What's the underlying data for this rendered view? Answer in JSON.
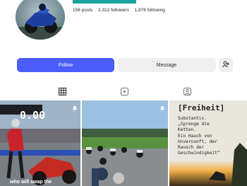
{
  "profile": {
    "stats": {
      "posts": "156 posts",
      "followers": "2,312 followers",
      "following": "1,976 following"
    }
  },
  "actions": {
    "follow_label": "Follow",
    "message_label": "Message"
  },
  "tabs": [
    {
      "icon": "grid-icon"
    },
    {
      "icon": "reels-icon"
    },
    {
      "icon": "tagged-icon"
    }
  ],
  "posts": [
    {
      "overlay_timer": "0.00",
      "caption": "who will swap the",
      "pinned": true
    },
    {
      "pinned": true
    },
    {
      "title": "[Freiheit]",
      "text": "Substantiv.\n„Sprenge die\nKetten.\nEin Hauch von\nUnvernunft, der\nRausch der\nGeschwindigkeit“"
    }
  ],
  "colors": {
    "accent": "#4a5df9",
    "highlight_bar": "#19a39a",
    "secondary_button": "#efefef"
  }
}
